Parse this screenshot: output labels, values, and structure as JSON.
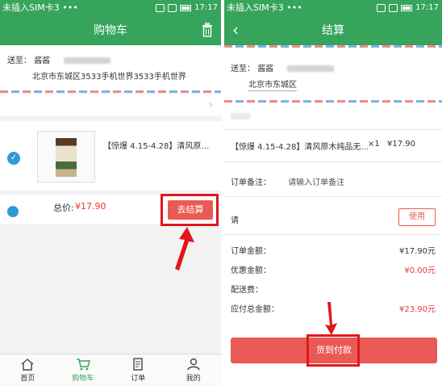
{
  "left": {
    "status": {
      "carrier": "未插入SIM卡3 •••",
      "time": "17:17"
    },
    "nav": {
      "title": "购物车"
    },
    "address": {
      "label": "送至：",
      "name": "酱酱",
      "detail": "北京市东城区3533手机世界3533手机世界"
    },
    "item": {
      "name": "【惊爆 4.15-4.28】清风原…"
    },
    "total": {
      "label": "总价:",
      "value": "¥17.90"
    },
    "checkout_label": "去结算",
    "tabs": [
      {
        "label": "首页",
        "icon": "home-icon"
      },
      {
        "label": "购物车",
        "icon": "cart-icon"
      },
      {
        "label": "订单",
        "icon": "order-icon"
      },
      {
        "label": "我的",
        "icon": "user-icon"
      }
    ]
  },
  "right": {
    "status": {
      "carrier": "未插入SIM卡3 •••",
      "time": "17:17"
    },
    "nav": {
      "title": "结算"
    },
    "address": {
      "label": "送至：",
      "name": "酱酱",
      "detail": "北京市东城区"
    },
    "item": {
      "name": "【惊爆 4.15-4.28】清风原木纯品无…",
      "qty": "×1",
      "price": "¥17.90"
    },
    "note": {
      "label": "订单备注：",
      "placeholder": "请输入订单备注"
    },
    "coupon": {
      "label": "请",
      "button": "使用"
    },
    "summary": [
      {
        "label": "订单金额：",
        "value": "¥17.90元"
      },
      {
        "label": "优惠金额：",
        "value": "¥0.00元"
      },
      {
        "label": "配送费：",
        "value": ""
      },
      {
        "label": "应付总金额：",
        "value": "¥23.90元"
      }
    ],
    "pay_label": "货到付款"
  },
  "colors": {
    "brand_green": "#37a45c",
    "accent_red": "#e95a55",
    "highlight_red": "#e0171d",
    "check_blue": "#2f9ad9"
  }
}
